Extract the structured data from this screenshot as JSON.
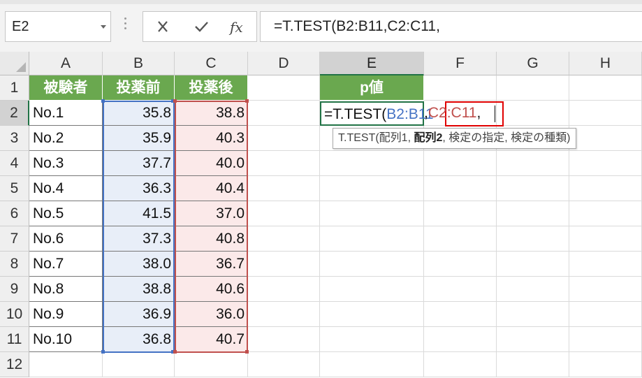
{
  "name_box": {
    "value": "E2"
  },
  "formula_bar": {
    "cancel_icon": "x-icon",
    "enter_icon": "check-icon",
    "fx_label": "fx",
    "formula": "=T.TEST(B2:B11,C2:C11,"
  },
  "columns": [
    "A",
    "B",
    "C",
    "D",
    "E",
    "F",
    "G",
    "H"
  ],
  "rows": [
    "1",
    "2",
    "3",
    "4",
    "5",
    "6",
    "7",
    "8",
    "9",
    "10",
    "11",
    "12"
  ],
  "table": {
    "headers": [
      "被験者",
      "投薬前",
      "投薬後"
    ],
    "data": [
      [
        "No.1",
        "35.8",
        "38.8"
      ],
      [
        "No.2",
        "35.9",
        "40.3"
      ],
      [
        "No.3",
        "37.7",
        "40.0"
      ],
      [
        "No.4",
        "36.3",
        "40.4"
      ],
      [
        "No.5",
        "41.5",
        "37.0"
      ],
      [
        "No.6",
        "37.3",
        "40.8"
      ],
      [
        "No.7",
        "38.0",
        "36.7"
      ],
      [
        "No.8",
        "38.8",
        "40.6"
      ],
      [
        "No.9",
        "36.9",
        "36.0"
      ],
      [
        "No.10",
        "36.8",
        "40.7"
      ]
    ]
  },
  "result": {
    "header": "p値",
    "edit": {
      "prefix": "=T.TEST(",
      "range1": "B2:B11",
      "comma1": ",",
      "range2": "C2:C11",
      "trailing": ","
    }
  },
  "tooltip": {
    "func": "T.TEST(",
    "arg1": "配列1, ",
    "arg2_bold": "配列2",
    "rest": ", 検定の指定, 検定の種類)"
  },
  "colors": {
    "header_fill": "#6aa84f",
    "range1": "#4472c4",
    "range2": "#c0504d",
    "active": "#217346"
  }
}
